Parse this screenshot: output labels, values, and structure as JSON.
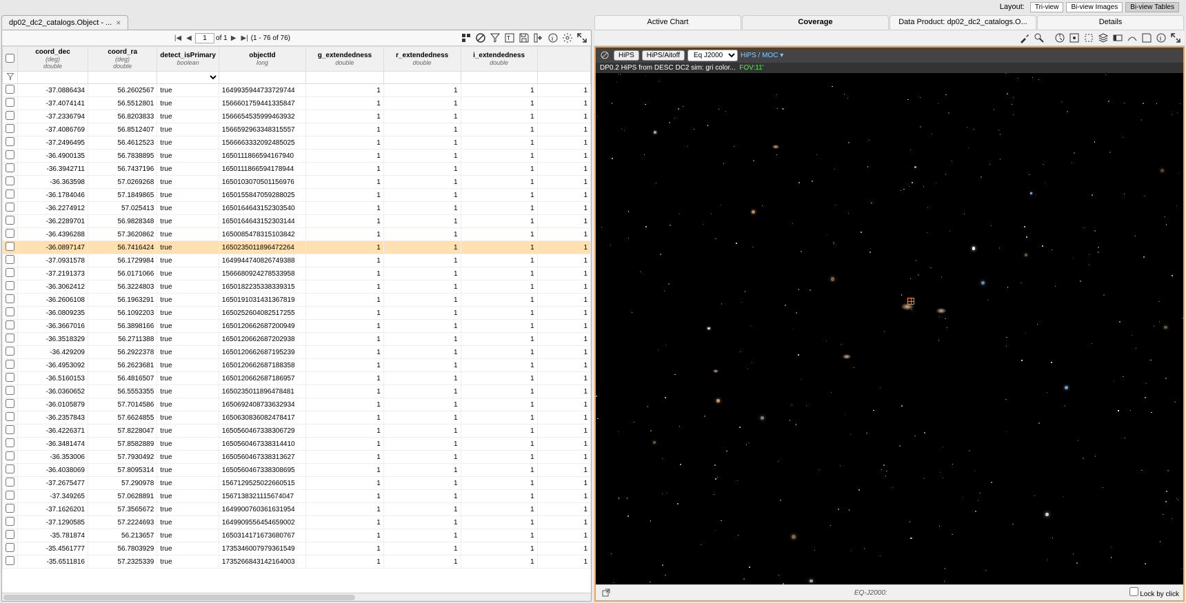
{
  "layout": {
    "label": "Layout:",
    "buttons": [
      "Tri-view",
      "Bi-view Images",
      "Bi-view Tables"
    ],
    "active": 2
  },
  "tableTab": {
    "title": "dp02_dc2_catalogs.Object - ..."
  },
  "pager": {
    "page": "1",
    "of": "of 1",
    "range": "(1 - 76 of 76)"
  },
  "columns": [
    {
      "name": "coord_dec",
      "unit": "(deg)",
      "type": "double"
    },
    {
      "name": "coord_ra",
      "unit": "(deg)",
      "type": "double"
    },
    {
      "name": "detect_isPrimary",
      "unit": "",
      "type": "boolean"
    },
    {
      "name": "objectId",
      "unit": "",
      "type": "long"
    },
    {
      "name": "g_extendedness",
      "unit": "",
      "type": "double"
    },
    {
      "name": "r_extendedness",
      "unit": "",
      "type": "double"
    },
    {
      "name": "i_extendedness",
      "unit": "",
      "type": "double"
    }
  ],
  "selectedRow": 12,
  "rows": [
    [
      "-37.0886434",
      "56.2602567",
      "true",
      "1649935944733729744",
      "1",
      "1",
      "1"
    ],
    [
      "-37.4074141",
      "56.5512801",
      "true",
      "1566601759441335847",
      "1",
      "1",
      "1"
    ],
    [
      "-37.2336794",
      "56.8203833",
      "true",
      "1566654535999463932",
      "1",
      "1",
      "1"
    ],
    [
      "-37.4086769",
      "56.8512407",
      "true",
      "1566592963348315557",
      "1",
      "1",
      "1"
    ],
    [
      "-37.2496495",
      "56.4612523",
      "true",
      "1566663332092485025",
      "1",
      "1",
      "1"
    ],
    [
      "-36.4900135",
      "56.7838895",
      "true",
      "1650111866594167940",
      "1",
      "1",
      "1"
    ],
    [
      "-36.3942711",
      "56.7437196",
      "true",
      "1650111866594178944",
      "1",
      "1",
      "1"
    ],
    [
      "-36.363598",
      "57.0269268",
      "true",
      "1650103070501156976",
      "1",
      "1",
      "1"
    ],
    [
      "-36.1784046",
      "57.1849865",
      "true",
      "1650155847059288025",
      "1",
      "1",
      "1"
    ],
    [
      "-36.2274912",
      "57.025413",
      "true",
      "1650164643152303540",
      "1",
      "1",
      "1"
    ],
    [
      "-36.2289701",
      "56.9828348",
      "true",
      "1650164643152303144",
      "1",
      "1",
      "1"
    ],
    [
      "-36.4396288",
      "57.3620862",
      "true",
      "1650085478315103842",
      "1",
      "1",
      "1"
    ],
    [
      "-36.0897147",
      "56.7416424",
      "true",
      "1650235011896472264",
      "1",
      "1",
      "1"
    ],
    [
      "-37.0931578",
      "56.1729984",
      "true",
      "1649944740826749388",
      "1",
      "1",
      "1"
    ],
    [
      "-37.2191373",
      "56.0171066",
      "true",
      "1566680924278533958",
      "1",
      "1",
      "1"
    ],
    [
      "-36.3062412",
      "56.3224803",
      "true",
      "1650182235338339315",
      "1",
      "1",
      "1"
    ],
    [
      "-36.2606108",
      "56.1963291",
      "true",
      "1650191031431367819",
      "1",
      "1",
      "1"
    ],
    [
      "-36.0809235",
      "56.1092203",
      "true",
      "1650252604082517255",
      "1",
      "1",
      "1"
    ],
    [
      "-36.3667016",
      "56.3898166",
      "true",
      "1650120662687200949",
      "1",
      "1",
      "1"
    ],
    [
      "-36.3518329",
      "56.2711388",
      "true",
      "1650120662687202938",
      "1",
      "1",
      "1"
    ],
    [
      "-36.429209",
      "56.2922378",
      "true",
      "1650120662687195239",
      "1",
      "1",
      "1"
    ],
    [
      "-36.4953092",
      "56.2623681",
      "true",
      "1650120662687188358",
      "1",
      "1",
      "1"
    ],
    [
      "-36.5160153",
      "56.4816507",
      "true",
      "1650120662687186957",
      "1",
      "1",
      "1"
    ],
    [
      "-36.0360652",
      "56.5553355",
      "true",
      "1650235011896478481",
      "1",
      "1",
      "1"
    ],
    [
      "-36.0105879",
      "57.7014586",
      "true",
      "1650692408733632934",
      "1",
      "1",
      "1"
    ],
    [
      "-36.2357843",
      "57.6624855",
      "true",
      "1650630836082478417",
      "1",
      "1",
      "1"
    ],
    [
      "-36.4226371",
      "57.8228047",
      "true",
      "1650560467338306729",
      "1",
      "1",
      "1"
    ],
    [
      "-36.3481474",
      "57.8582889",
      "true",
      "1650560467338314410",
      "1",
      "1",
      "1"
    ],
    [
      "-36.353006",
      "57.7930492",
      "true",
      "1650560467338313627",
      "1",
      "1",
      "1"
    ],
    [
      "-36.4038069",
      "57.8095314",
      "true",
      "1650560467338308695",
      "1",
      "1",
      "1"
    ],
    [
      "-37.2675477",
      "57.290978",
      "true",
      "1567129525022660515",
      "1",
      "1",
      "1"
    ],
    [
      "-37.349265",
      "57.0628891",
      "true",
      "1567138321115674047",
      "1",
      "1",
      "1"
    ],
    [
      "-37.1626201",
      "57.3565672",
      "true",
      "1649900760361631954",
      "1",
      "1",
      "1"
    ],
    [
      "-37.1290585",
      "57.2224693",
      "true",
      "1649909556454659002",
      "1",
      "1",
      "1"
    ],
    [
      "-35.781874",
      "56.213657",
      "true",
      "1650314171673680767",
      "1",
      "1",
      "1"
    ],
    [
      "-35.4561777",
      "56.7803929",
      "true",
      "1735346007979361549",
      "1",
      "1",
      "1"
    ],
    [
      "-35.6511816",
      "57.2325339",
      "true",
      "1735266843142164003",
      "1",
      "1",
      "1"
    ]
  ],
  "rightTabs": [
    "Active Chart",
    "Coverage",
    "Data Product: dp02_dc2_catalogs.O...",
    "Details"
  ],
  "rightActive": 1,
  "imgHeader": {
    "hips": "HiPS",
    "proj": "HiPS/Aitoff",
    "frame": "Eq J2000",
    "moc": "HiPS / MOC"
  },
  "imgLabel": {
    "text": "DP0.2 HiPS from DESC DC2 sim: gri color...",
    "fov": "FOV:11'"
  },
  "imgFooter": {
    "coord": "EQ-J2000:",
    "lock": "Lock by click"
  }
}
